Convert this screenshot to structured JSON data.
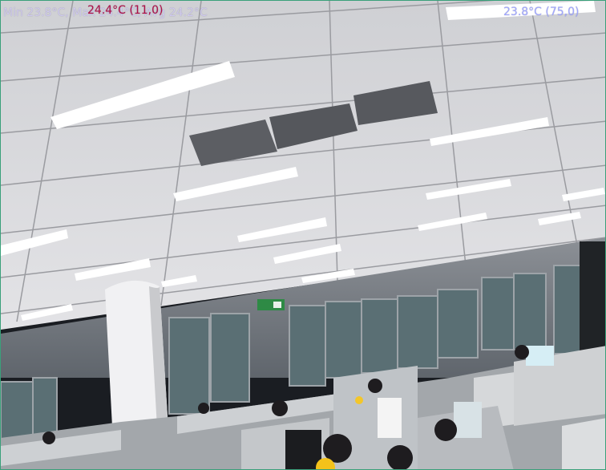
{
  "overlay": {
    "stats_text": "Min 23.8°C, Max 24.4°C, Avg 24.2°C",
    "hotspot_label": "24.4°C (11,0)",
    "coldspot_label": "23.8°C (75,0)"
  },
  "colors": {
    "stats_text": "#cfc9ee",
    "hotspot_text": "#b0104a",
    "coldspot_text": "#9ea5ff",
    "frame_border": "#3aa07a"
  },
  "scene": {
    "description_icons": [
      "ceiling-lights",
      "pillar",
      "cubicles",
      "windows",
      "exit-sign"
    ]
  }
}
